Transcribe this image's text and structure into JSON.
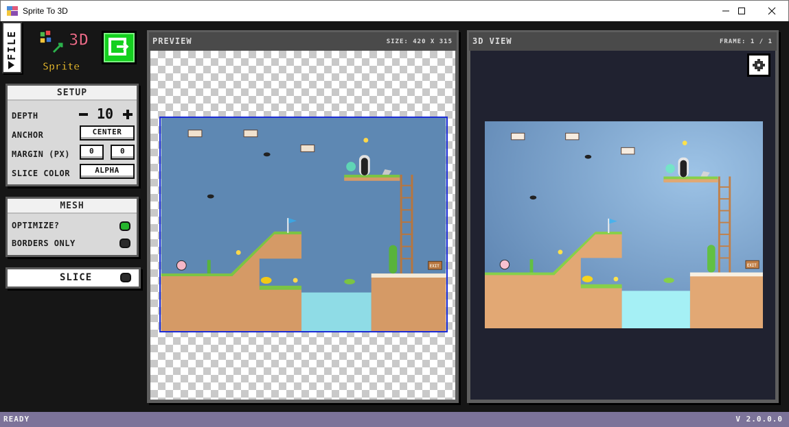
{
  "window": {
    "title": "Sprite To 3D",
    "minimize_icon": "minimize-icon",
    "maximize_icon": "maximize-icon",
    "close_icon": "close-icon"
  },
  "sidebar": {
    "file_tab": "FILE",
    "logo_text_top": "3D",
    "logo_text_bottom": "Sprite",
    "export_icon": "export-icon"
  },
  "setup": {
    "title": "SETUP",
    "depth_label": "DEPTH",
    "depth_value": "10",
    "anchor_label": "ANCHOR",
    "anchor_value": "CENTER",
    "margin_label": "MARGIN (PX)",
    "margin_x": "0",
    "margin_y": "0",
    "slice_color_label": "SLICE COLOR",
    "slice_color_value": "ALPHA"
  },
  "mesh": {
    "title": "MESH",
    "optimize_label": "OPTIMIZE?",
    "optimize_on": true,
    "borders_only_label": "BORDERS ONLY",
    "borders_only_on": false
  },
  "slice": {
    "label": "SLICE"
  },
  "preview": {
    "title": "PREVIEW",
    "size_info": "SIZE: 420 X 315",
    "sign_text": "EXIT"
  },
  "view3d": {
    "title": "3D VIEW",
    "frame_info": "FRAME: 1 / 1",
    "settings_icon": "gear-icon",
    "sign_text": "EXIT"
  },
  "status": {
    "left": "READY",
    "right": "V 2.0.0.0"
  },
  "colors": {
    "sky": "#5e88b3",
    "grass": "#7bc443",
    "dirt": "#d59a66",
    "water": "#8fdce6",
    "status_bar": "#7c7399",
    "export_green": "#14d01f"
  }
}
